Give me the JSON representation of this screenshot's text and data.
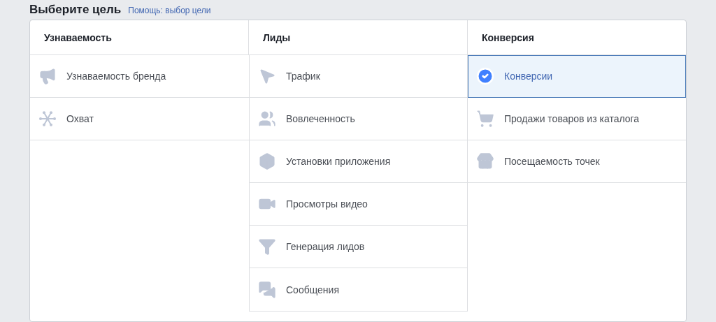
{
  "header": {
    "title": "Выберите цель",
    "help_link": "Помощь: выбор цели"
  },
  "columns": [
    {
      "title": "Узнаваемость",
      "items": [
        {
          "label": "Узнаваемость бренда",
          "kind": "brand",
          "selected": false
        },
        {
          "label": "Охват",
          "kind": "reach",
          "selected": false
        }
      ]
    },
    {
      "title": "Лиды",
      "items": [
        {
          "label": "Трафик",
          "kind": "traffic",
          "selected": false
        },
        {
          "label": "Вовлеченность",
          "kind": "engagement",
          "selected": false
        },
        {
          "label": "Установки приложения",
          "kind": "installs",
          "selected": false
        },
        {
          "label": "Просмотры видео",
          "kind": "video",
          "selected": false
        },
        {
          "label": "Генерация лидов",
          "kind": "leads",
          "selected": false
        },
        {
          "label": "Сообщения",
          "kind": "messages",
          "selected": false
        }
      ]
    },
    {
      "title": "Конверсия",
      "items": [
        {
          "label": "Конверсии",
          "selected": true
        },
        {
          "label": "Продажи товаров из каталога",
          "kind": "catalog",
          "selected": false
        },
        {
          "label": "Посещаемость точек",
          "kind": "store",
          "selected": false
        }
      ]
    }
  ]
}
